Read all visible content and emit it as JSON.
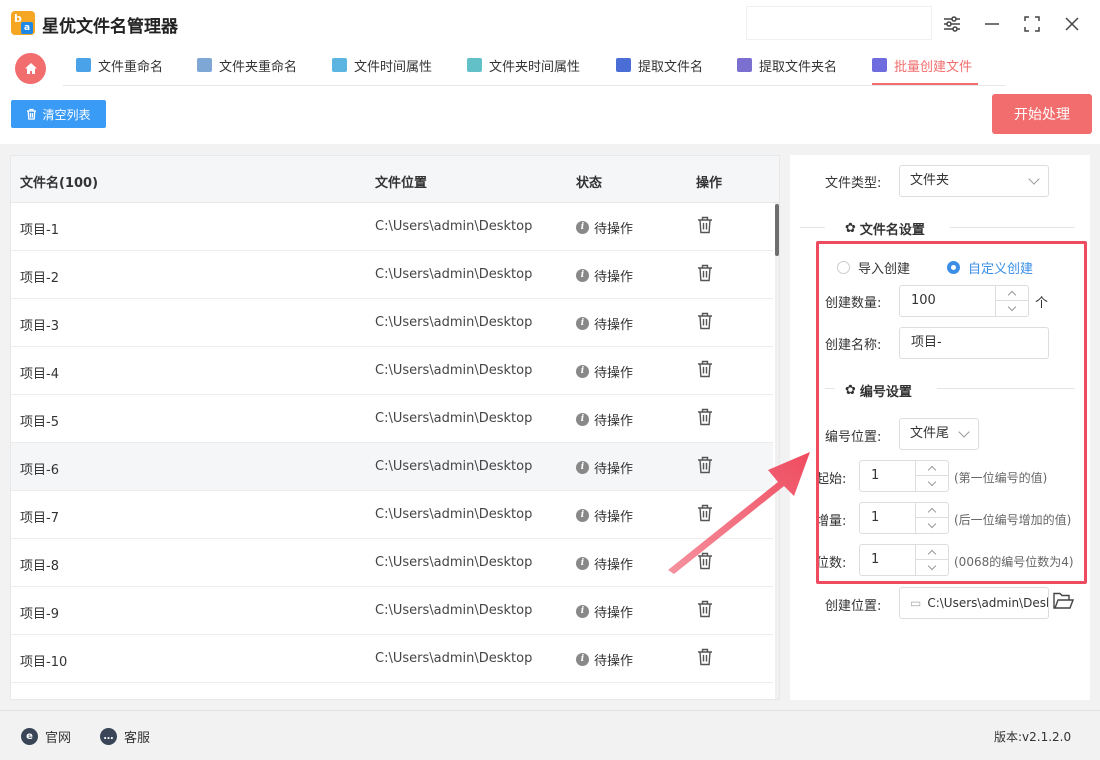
{
  "app": {
    "title": "星优文件名管理器"
  },
  "nav": {
    "tabs": [
      {
        "label": "文件重命名",
        "color": "#4aa3e8"
      },
      {
        "label": "文件夹重命名",
        "color": "#7fa7d6"
      },
      {
        "label": "文件时间属性",
        "color": "#5bb5e0"
      },
      {
        "label": "文件夹时间属性",
        "color": "#62c0c9"
      },
      {
        "label": "提取文件名",
        "color": "#4b6ed6"
      },
      {
        "label": "提取文件夹名",
        "color": "#7b6fd0"
      },
      {
        "label": "批量创建文件",
        "color": "#6f6ce0"
      }
    ],
    "active_tab": "批量创建文件"
  },
  "toolbar": {
    "clear_label": "清空列表",
    "start_label": "开始处理"
  },
  "table": {
    "headers": {
      "name": "文件名(100)",
      "path": "文件位置",
      "status": "状态",
      "op": "操作"
    },
    "rows": [
      {
        "name": "项目-1",
        "path": "C:\\Users\\admin\\Desktop",
        "status": "待操作"
      },
      {
        "name": "项目-2",
        "path": "C:\\Users\\admin\\Desktop",
        "status": "待操作"
      },
      {
        "name": "项目-3",
        "path": "C:\\Users\\admin\\Desktop",
        "status": "待操作"
      },
      {
        "name": "项目-4",
        "path": "C:\\Users\\admin\\Desktop",
        "status": "待操作"
      },
      {
        "name": "项目-5",
        "path": "C:\\Users\\admin\\Desktop",
        "status": "待操作"
      },
      {
        "name": "项目-6",
        "path": "C:\\Users\\admin\\Desktop",
        "status": "待操作"
      },
      {
        "name": "项目-7",
        "path": "C:\\Users\\admin\\Desktop",
        "status": "待操作"
      },
      {
        "name": "项目-8",
        "path": "C:\\Users\\admin\\Desktop",
        "status": "待操作"
      },
      {
        "name": "项目-9",
        "path": "C:\\Users\\admin\\Desktop",
        "status": "待操作"
      },
      {
        "name": "项目-10",
        "path": "C:\\Users\\admin\\Desktop",
        "status": "待操作"
      }
    ],
    "highlighted_row": 6
  },
  "panel": {
    "file_type_label": "文件类型:",
    "file_type_value": "文件夹",
    "name_section": "文件名设置",
    "radio_import": "导入创建",
    "radio_custom": "自定义创建",
    "selected_mode": "自定义创建",
    "count_label": "创建数量:",
    "count_value": "100",
    "count_unit": "个",
    "name_label": "创建名称:",
    "name_value": "项目-",
    "number_section": "编号设置",
    "num_pos_label": "编号位置:",
    "num_pos_value": "文件尾",
    "start_label": "起始:",
    "start_value": "1",
    "start_hint": "(第一位编号的值)",
    "step_label": "增量:",
    "step_value": "1",
    "step_hint": "(后一位编号增加的值)",
    "digits_label": "位数:",
    "digits_value": "1",
    "digits_hint": "(0068的编号位数为4)",
    "location_label": "创建位置:",
    "location_value": "C:\\Users\\admin\\Desktop"
  },
  "footer": {
    "site": "官网",
    "service": "客服",
    "version": "版本:v2.1.2.0"
  },
  "colors": {
    "accent_red": "#f26d6d",
    "accent_blue": "#3a9bf6",
    "annotation": "#ef4b5f"
  }
}
